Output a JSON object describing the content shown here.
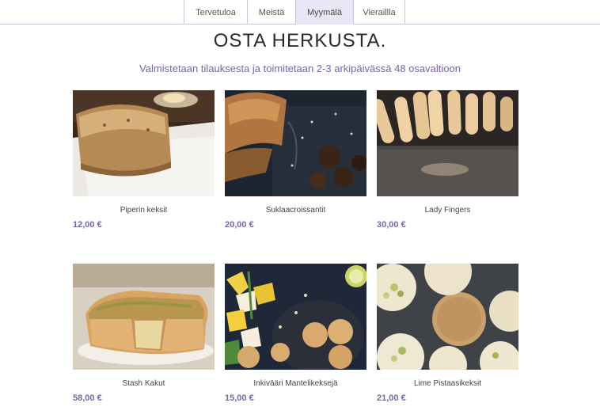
{
  "nav": {
    "tabs": [
      {
        "label": "Tervetuloa",
        "active": false
      },
      {
        "label": "Meistä",
        "active": false
      },
      {
        "label": "Myymälä",
        "active": true
      },
      {
        "label": "Vieraillla",
        "active": false
      }
    ]
  },
  "header": {
    "title": "OSTA HERKUSTA.",
    "subtitle": "Valmistetaan tilauksesta ja toimitetaan 2-3 arkipäivässä 48 osavaltioon"
  },
  "products": [
    {
      "name": "Piperin keksit",
      "price": "12,00 €"
    },
    {
      "name": "Suklaacroissantit",
      "price": "20,00 €"
    },
    {
      "name": "Lady Fingers",
      "price": "30,00 €"
    },
    {
      "name": "Stash Kakut",
      "price": "58,00 €"
    },
    {
      "name": "Inkivääri Mantelikeksejä",
      "price": "15,00 €"
    },
    {
      "name": "Lime Pistaasikeksit",
      "price": "21,00 €"
    }
  ],
  "colors": {
    "accent": "#7a64a8",
    "border": "#c9c4d6",
    "active_tab": "#ebe6f5"
  }
}
